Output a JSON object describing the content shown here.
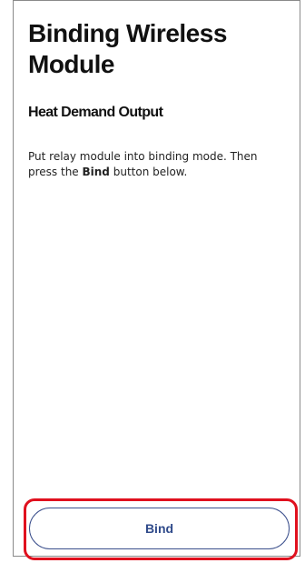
{
  "screen": {
    "title": "Binding Wireless Module",
    "subtitle": "Heat Demand Output",
    "instructions": {
      "part1": "Put relay module into binding mode. Then press the ",
      "bold": "Bind",
      "part2": " button below."
    }
  },
  "actions": {
    "bind_label": "Bind"
  },
  "colors": {
    "accent": "#2f4a8a",
    "highlight": "#e0101e",
    "frame_border": "#8a8a8a"
  }
}
